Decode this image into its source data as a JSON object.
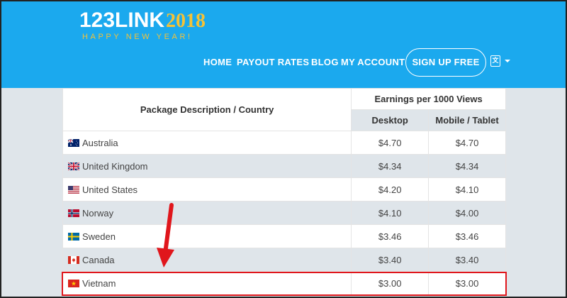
{
  "header": {
    "logo_text": "123LINK",
    "logo_year": "2018",
    "logo_tagline": "HAPPY NEW YEAR!",
    "accent_color": "#1ba9ee",
    "logo_gold": "#f5c236"
  },
  "nav": {
    "home": "HOME",
    "payout_rates": "PAYOUT RATES",
    "blog": "BLOG",
    "my_account": "MY ACCOUNT",
    "sign_up": "SIGN UP FREE",
    "language_icon": "translate-icon"
  },
  "table": {
    "header_package": "Package Description / Country",
    "header_earnings": "Earnings per 1000 Views",
    "header_desktop": "Desktop",
    "header_mobile": "Mobile / Tablet",
    "rows": [
      {
        "country": "Australia",
        "flag": "flag-australia-icon",
        "desktop": "$4.70",
        "mobile": "$4.70"
      },
      {
        "country": "United Kingdom",
        "flag": "flag-uk-icon",
        "desktop": "$4.34",
        "mobile": "$4.34"
      },
      {
        "country": "United States",
        "flag": "flag-us-icon",
        "desktop": "$4.20",
        "mobile": "$4.10"
      },
      {
        "country": "Norway",
        "flag": "flag-norway-icon",
        "desktop": "$4.10",
        "mobile": "$4.00"
      },
      {
        "country": "Sweden",
        "flag": "flag-sweden-icon",
        "desktop": "$3.46",
        "mobile": "$3.46"
      },
      {
        "country": "Canada",
        "flag": "flag-canada-icon",
        "desktop": "$3.40",
        "mobile": "$3.40"
      },
      {
        "country": "Vietnam",
        "flag": "flag-vietnam-icon",
        "desktop": "$3.00",
        "mobile": "$3.00"
      }
    ]
  },
  "annotation": {
    "highlight_color": "#e0161c"
  }
}
